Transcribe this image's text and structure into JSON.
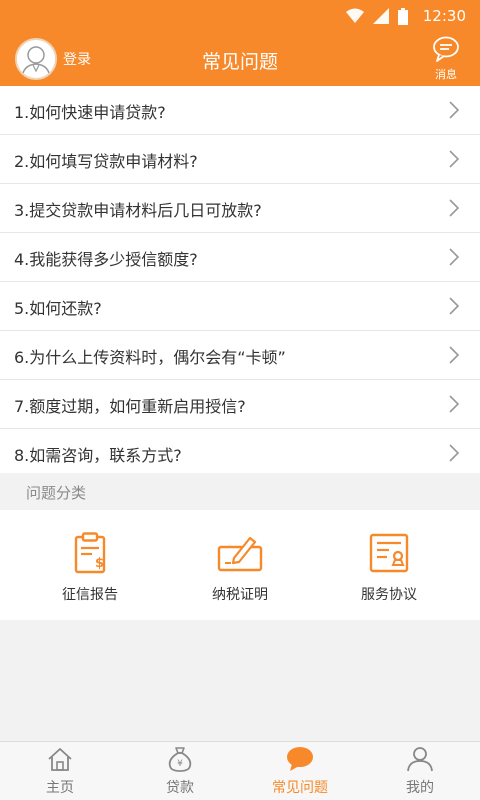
{
  "status_bar": {
    "time": "12:30"
  },
  "header": {
    "login_label": "登录",
    "title": "常见问题",
    "message_label": "消息"
  },
  "faq": [
    "1.如何快速申请贷款?",
    "2.如何填写贷款申请材料?",
    "3.提交贷款申请材料后几日可放款?",
    "4.我能获得多少授信额度?",
    "5.如何还款?",
    "6.为什么上传资料时，偶尔会有“卡顿”",
    "7.额度过期，如何重新启用授信?",
    "8.如需咨询，联系方式?"
  ],
  "category": {
    "title": "问题分类",
    "items": [
      {
        "label": "征信报告",
        "icon": "credit-report-icon"
      },
      {
        "label": "纳税证明",
        "icon": "tax-certificate-icon"
      },
      {
        "label": "服务协议",
        "icon": "service-agreement-icon"
      }
    ]
  },
  "bottom_nav": [
    {
      "label": "主页",
      "icon": "home-icon"
    },
    {
      "label": "贷款",
      "icon": "money-bag-icon"
    },
    {
      "label": "常见问题",
      "icon": "chat-bubble-icon",
      "active": true
    },
    {
      "label": "我的",
      "icon": "user-icon"
    }
  ],
  "colors": {
    "accent": "#f7892a",
    "background": "#f2f2f2",
    "text": "#333333"
  }
}
